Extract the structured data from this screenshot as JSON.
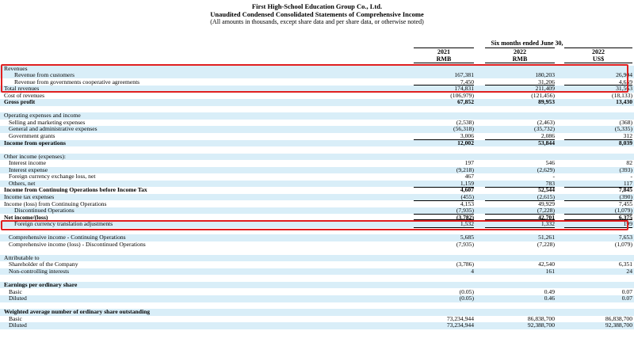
{
  "header": {
    "company": "First High-School Education Group Co., Ltd.",
    "statement": "Unaudited Condensed Consolidated Statements of Comprehensive Income",
    "note": "(All amounts in thousands, except share data and per share data, or otherwise noted)",
    "period": "Six months ended June 30,",
    "columns": [
      {
        "year": "2021",
        "unit": "RMB"
      },
      {
        "year": "2022",
        "unit": "RMB"
      },
      {
        "year": "2022",
        "unit": "US$"
      }
    ]
  },
  "rows": [
    {
      "label": "Revenues",
      "values": [
        "",
        "",
        ""
      ],
      "indent": 0,
      "bold": false,
      "shaded": true
    },
    {
      "label": "Revenue from customers",
      "values": [
        "167,381",
        "180,203",
        "26,904"
      ],
      "indent": 2,
      "bold": false,
      "shaded": true
    },
    {
      "label": "Revenue from governments cooperative agreements",
      "values": [
        "7,450",
        "31,206",
        "4,659"
      ],
      "indent": 2,
      "bold": false,
      "shaded": false,
      "underline": true
    },
    {
      "label": "Total revenues",
      "values": [
        "174,831",
        "211,409",
        "31,563"
      ],
      "indent": 0,
      "bold": false,
      "shaded": true
    },
    {
      "label": "Cost of revenues",
      "values": [
        "(106,979)",
        "(121,456)",
        "(18,133)"
      ],
      "indent": 0,
      "bold": false,
      "shaded": false,
      "underline": true
    },
    {
      "label": "Gross profit",
      "values": [
        "67,852",
        "89,953",
        "13,430"
      ],
      "indent": 0,
      "bold": true,
      "shaded": true
    },
    {
      "label": "",
      "values": [
        "",
        "",
        ""
      ],
      "indent": 0,
      "bold": false,
      "shaded": false
    },
    {
      "label": "Operating expenses and income",
      "values": [
        "",
        "",
        ""
      ],
      "indent": 0,
      "bold": false,
      "shaded": true
    },
    {
      "label": "Selling and marketing expenses",
      "values": [
        "(2,538)",
        "(2,463)",
        "(368)"
      ],
      "indent": 1,
      "bold": false,
      "shaded": false
    },
    {
      "label": "General and administrative expenses",
      "values": [
        "(56,318)",
        "(35,732)",
        "(5,335)"
      ],
      "indent": 1,
      "bold": false,
      "shaded": true
    },
    {
      "label": "Government grants",
      "values": [
        "3,006",
        "2,086",
        "312"
      ],
      "indent": 1,
      "bold": false,
      "shaded": false,
      "underline": true
    },
    {
      "label": "Income from operations",
      "values": [
        "12,002",
        "53,844",
        "8,039"
      ],
      "indent": 0,
      "bold": true,
      "shaded": true
    },
    {
      "label": "",
      "values": [
        "",
        "",
        ""
      ],
      "indent": 0,
      "bold": false,
      "shaded": false
    },
    {
      "label": "Other income (expenses):",
      "values": [
        "",
        "",
        ""
      ],
      "indent": 0,
      "bold": false,
      "shaded": true
    },
    {
      "label": "Interest income",
      "values": [
        "197",
        "546",
        "82"
      ],
      "indent": 1,
      "bold": false,
      "shaded": false
    },
    {
      "label": "Interest expense",
      "values": [
        "(9,218)",
        "(2,629)",
        "(393)"
      ],
      "indent": 1,
      "bold": false,
      "shaded": true
    },
    {
      "label": "Foreign currency exchange loss, net",
      "values": [
        "467",
        "-",
        "-"
      ],
      "indent": 1,
      "bold": false,
      "shaded": false
    },
    {
      "label": "Others, net",
      "values": [
        "1,159",
        "783",
        "117"
      ],
      "indent": 1,
      "bold": false,
      "shaded": true,
      "underline": true
    },
    {
      "label": "Income from Continuing Operations before Income Tax",
      "values": [
        "4,607",
        "52,544",
        "7,845"
      ],
      "indent": 0,
      "bold": true,
      "shaded": false
    },
    {
      "label": "Income tax expenses",
      "values": [
        "(455)",
        "(2,615)",
        "(390)"
      ],
      "indent": 0,
      "bold": false,
      "shaded": true,
      "underline": true
    },
    {
      "label": "Income (loss) from Continuing Operations",
      "values": [
        "4,153",
        "49,929",
        "7,455"
      ],
      "indent": 0,
      "bold": false,
      "shaded": false
    },
    {
      "label": "Discontinued Operations",
      "values": [
        "(7,935)",
        "(7,228)",
        "(1,079)"
      ],
      "indent": 2,
      "bold": false,
      "shaded": true,
      "underline": true
    },
    {
      "label": "Net income/(loss)",
      "values": [
        "(3,782)",
        "42,701",
        "6,375"
      ],
      "indent": 0,
      "bold": true,
      "shaded": false,
      "double": true
    },
    {
      "label": "Foreign currency translation adjustments",
      "values": [
        "1,532",
        "1,332",
        "199"
      ],
      "indent": 2,
      "bold": false,
      "shaded": true,
      "underline": true
    },
    {
      "label": "",
      "values": [
        "",
        "",
        ""
      ],
      "indent": 0,
      "bold": false,
      "shaded": false
    },
    {
      "label": "Comprehensive income - Continuing Operations",
      "values": [
        "5,685",
        "51,261",
        "7,653"
      ],
      "indent": 1,
      "bold": false,
      "shaded": true
    },
    {
      "label": "Comprehensive income (loss) - Discontinued Operations",
      "values": [
        "(7,935)",
        "(7,228)",
        "(1,079)"
      ],
      "indent": 1,
      "bold": false,
      "shaded": false
    },
    {
      "label": "",
      "values": [
        "",
        "",
        ""
      ],
      "indent": 0,
      "bold": false,
      "shaded": false
    },
    {
      "label": "Attributable to",
      "values": [
        "",
        "",
        ""
      ],
      "indent": 0,
      "bold": false,
      "shaded": true
    },
    {
      "label": "Shareholder of the Company",
      "values": [
        "(3,786)",
        "42,540",
        "6,351"
      ],
      "indent": 1,
      "bold": false,
      "shaded": false
    },
    {
      "label": "Non-controlling interests",
      "values": [
        "4",
        "161",
        "24"
      ],
      "indent": 1,
      "bold": false,
      "shaded": true
    },
    {
      "label": "",
      "values": [
        "",
        "",
        ""
      ],
      "indent": 0,
      "bold": false,
      "shaded": false
    },
    {
      "label": "Earnings per ordinary share",
      "values": [
        "",
        "",
        ""
      ],
      "indent": 0,
      "bold": true,
      "shaded": true
    },
    {
      "label": "Basic",
      "values": [
        "(0.05)",
        "0.49",
        "0.07"
      ],
      "indent": 1,
      "bold": false,
      "shaded": false
    },
    {
      "label": "Diluted",
      "values": [
        "(0.05)",
        "0.46",
        "0.07"
      ],
      "indent": 1,
      "bold": false,
      "shaded": true
    },
    {
      "label": "",
      "values": [
        "",
        "",
        ""
      ],
      "indent": 0,
      "bold": false,
      "shaded": false
    },
    {
      "label": "Weighted average number of ordinary share outstanding",
      "values": [
        "",
        "",
        ""
      ],
      "indent": 0,
      "bold": true,
      "shaded": true
    },
    {
      "label": "Basic",
      "values": [
        "73,234,944",
        "86,838,700",
        "86,838,700"
      ],
      "indent": 1,
      "bold": false,
      "shaded": false
    },
    {
      "label": "Diluted",
      "values": [
        "73,234,944",
        "92,388,700",
        "92,388,700"
      ],
      "indent": 1,
      "bold": false,
      "shaded": true
    }
  ],
  "colors": {
    "highlight": "#e02020",
    "shade": "#d9eef8"
  }
}
